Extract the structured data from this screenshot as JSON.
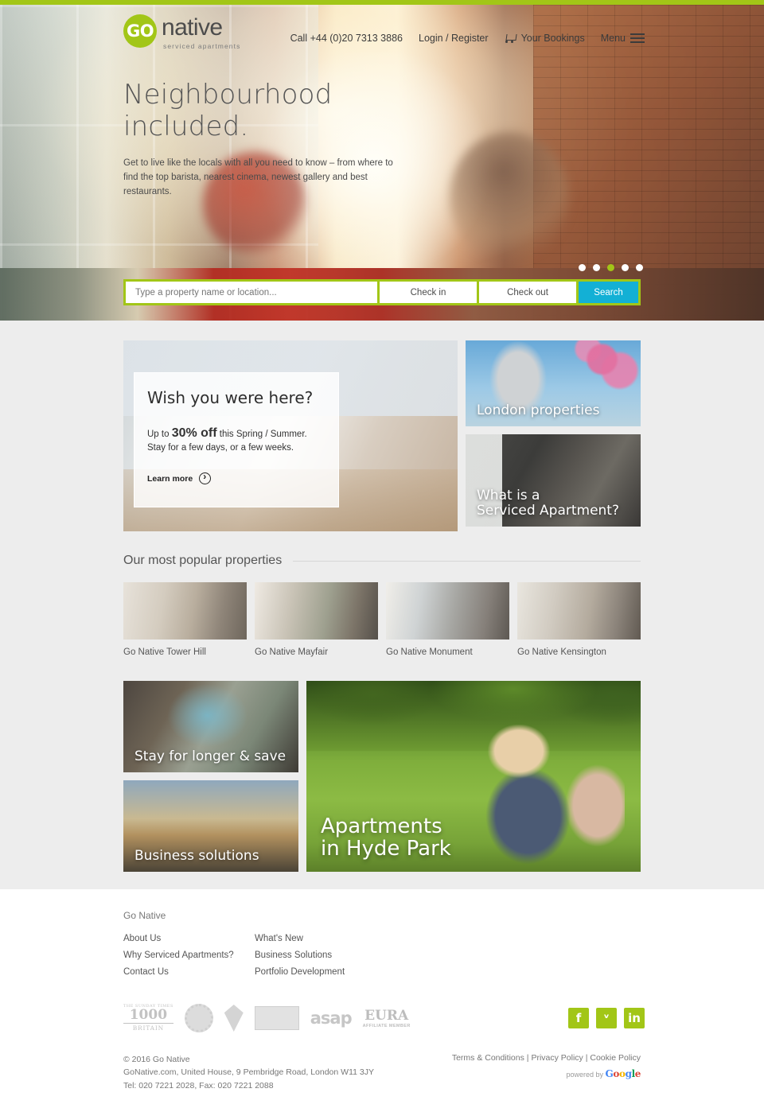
{
  "brand": {
    "logo_mark": "GO",
    "logo_word": "native",
    "logo_tagline": "serviced apartments",
    "accent_color": "#A2C617",
    "search_button_color": "#13B0D5"
  },
  "header": {
    "phone": "Call +44 (0)20 7313 3886",
    "login": "Login / Register",
    "bookings": "Your Bookings",
    "menu": "Menu"
  },
  "hero": {
    "title": "Neighbourhood included.",
    "subtitle": "Get to live like the locals with all you need to know – from where to find the top barista, nearest cinema, newest gallery and best restaurants.",
    "carousel_dots": 5,
    "carousel_active_index": 2
  },
  "search": {
    "placeholder": "Type a property name or location...",
    "value": "",
    "checkin_label": "Check in",
    "checkout_label": "Check out",
    "button_label": "Search"
  },
  "promo": {
    "heading": "Wish you were here?",
    "line1_pre": "Up to ",
    "line1_strong": "30% off",
    "line1_post": " this Spring / Summer.",
    "line2": "Stay for a few days, or a few weeks.",
    "cta": "Learn more"
  },
  "tiles": {
    "london": "London properties",
    "serviced_apartment_l1": "What is a",
    "serviced_apartment_l2": "Serviced Apartment?",
    "stay_longer": "Stay for longer & save",
    "business": "Business solutions",
    "hyde_l1": "Apartments",
    "hyde_l2": "in Hyde Park"
  },
  "popular": {
    "section_title": "Our most popular properties",
    "items": [
      {
        "name": "Go Native Tower Hill"
      },
      {
        "name": "Go Native Mayfair"
      },
      {
        "name": "Go Native Monument"
      },
      {
        "name": "Go Native Kensington"
      }
    ]
  },
  "footer": {
    "title": "Go Native",
    "col1": [
      "About Us",
      "Why Serviced Apartments?",
      "Contact Us"
    ],
    "col2": [
      "What's New",
      "Business Solutions",
      "Portfolio Development"
    ],
    "badges": {
      "b1000_tiny": "THE SUNDAY TIMES",
      "b1000_big": "1000",
      "b1000_bot": "BRITAIN",
      "asap": "asap",
      "eura_title": "EURA",
      "eura_sub": "AFFILIATE MEMBER"
    },
    "socials": [
      {
        "name": "facebook",
        "glyph": "f"
      },
      {
        "name": "twitter",
        "glyph": "ᵛ"
      },
      {
        "name": "linkedin",
        "glyph": "in"
      }
    ],
    "copyright": "© 2016 Go Native",
    "address": "GoNative.com, United House, 9 Pembridge Road, London W11 3JY",
    "phone": "Tel: 020 7221 2028, Fax: 020 7221 2088",
    "terms": "Terms & Conditions",
    "privacy": "Privacy Policy",
    "cookie": "Cookie Policy",
    "sep": "|",
    "powered_by": "powered by"
  }
}
